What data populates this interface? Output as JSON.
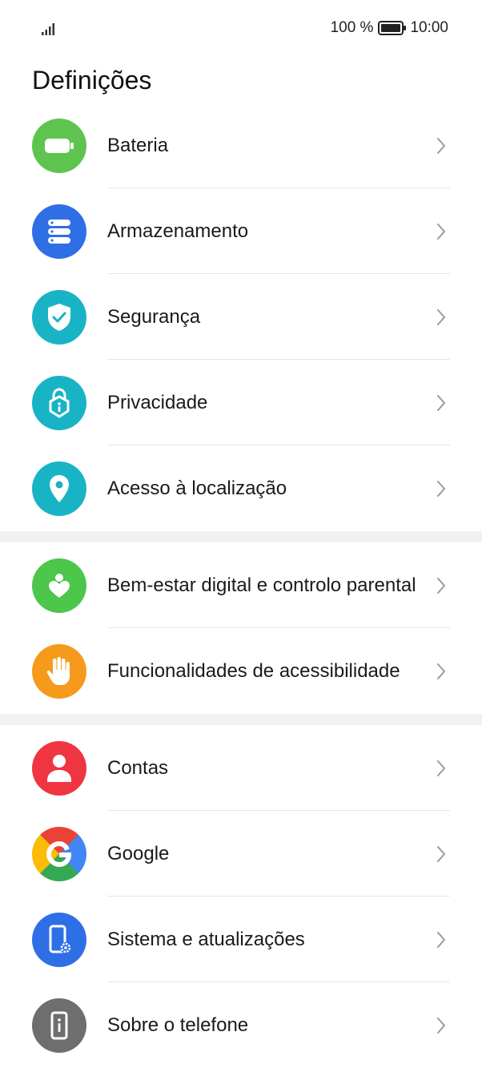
{
  "status_bar": {
    "signal_icon": "signal-icon",
    "battery_percent": "100 %",
    "battery_icon": "battery-full-icon",
    "time": "10:00"
  },
  "page": {
    "title": "Definições"
  },
  "groups": [
    {
      "items": [
        {
          "label": "Bateria",
          "icon": "battery-icon",
          "color": "#5ec44f"
        },
        {
          "label": "Armazenamento",
          "icon": "storage-icon",
          "color": "#2f6fe6"
        },
        {
          "label": "Segurança",
          "icon": "shield-check-icon",
          "color": "#19b3c6"
        },
        {
          "label": "Privacidade",
          "icon": "privacy-lock-icon",
          "color": "#19b3c6"
        },
        {
          "label": "Acesso à localização",
          "icon": "location-pin-icon",
          "color": "#19b3c6"
        }
      ]
    },
    {
      "items": [
        {
          "label": "Bem-estar digital e controlo parental",
          "icon": "digital-wellbeing-icon",
          "color": "#4cc64b"
        },
        {
          "label": "Funcionalidades de acessibilidade",
          "icon": "hand-icon",
          "color": "#f59a1b"
        }
      ]
    },
    {
      "items": [
        {
          "label": "Contas",
          "icon": "user-icon",
          "color": "#ef3540"
        },
        {
          "label": "Google",
          "icon": "google-icon",
          "color": "#4285f4"
        },
        {
          "label": "Sistema e atualizações",
          "icon": "system-update-icon",
          "color": "#2f6fe6"
        },
        {
          "label": "Sobre o telefone",
          "icon": "phone-info-icon",
          "color": "#6e6e6e"
        }
      ]
    }
  ]
}
